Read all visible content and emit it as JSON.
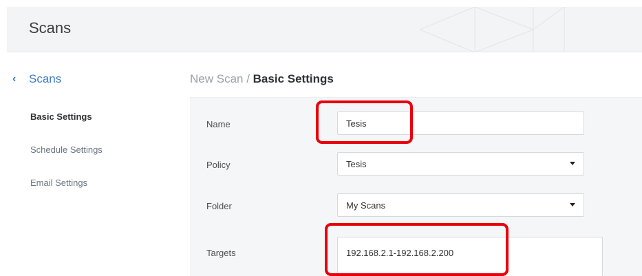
{
  "header": {
    "title": "Scans"
  },
  "sidebar": {
    "back_label": "Scans",
    "back_icon": "chevron-left-icon",
    "items": [
      {
        "label": "Basic Settings",
        "active": true
      },
      {
        "label": "Schedule Settings",
        "active": false
      },
      {
        "label": "Email Settings",
        "active": false
      }
    ]
  },
  "breadcrumb": {
    "parent": "New Scan",
    "separator": " / ",
    "current": "Basic Settings"
  },
  "form": {
    "name": {
      "label": "Name",
      "value": "Tesis"
    },
    "policy": {
      "label": "Policy",
      "value": "Tesis"
    },
    "folder": {
      "label": "Folder",
      "value": "My Scans"
    },
    "targets": {
      "label": "Targets",
      "value": "192.168.2.1-192.168.2.200"
    }
  },
  "colors": {
    "accent": "#3b7bbf",
    "highlight": "#e8000b",
    "panel": "#f5f6f7"
  }
}
